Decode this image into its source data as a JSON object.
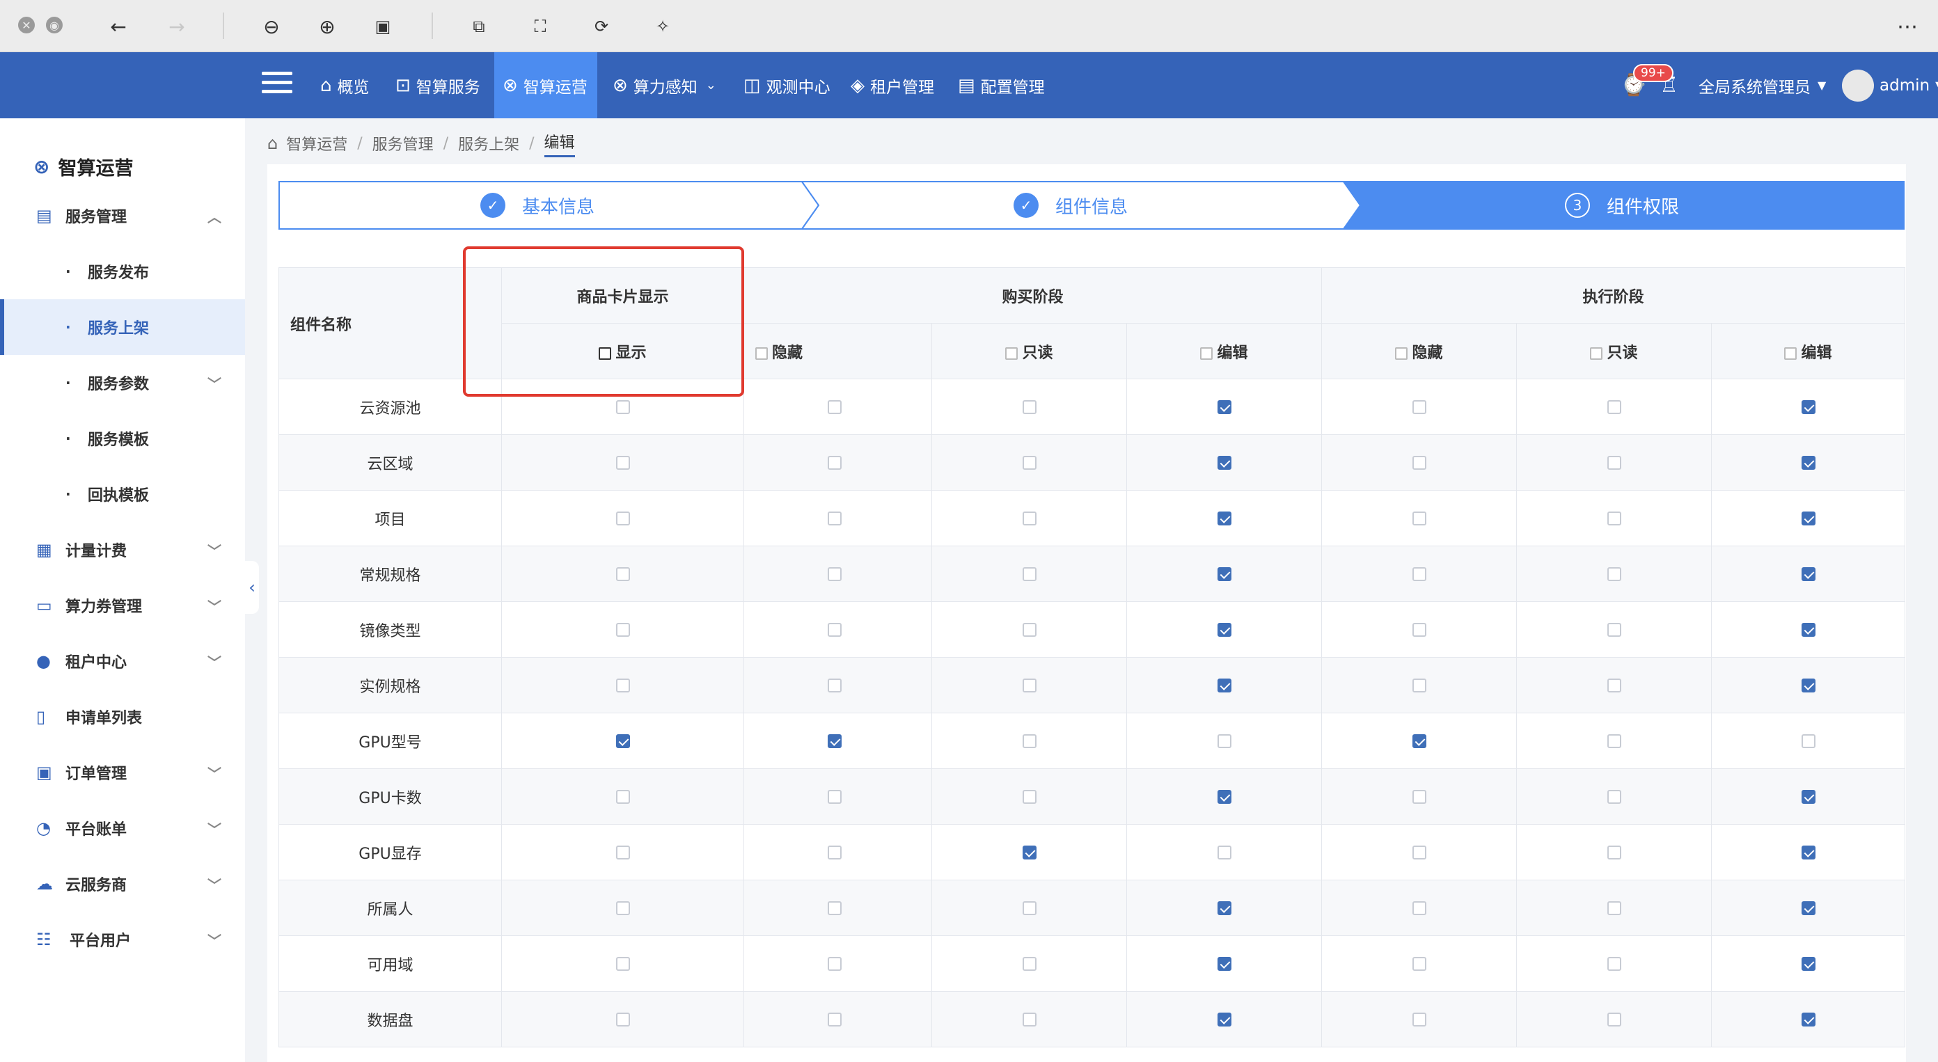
{
  "navbar": {
    "items": [
      {
        "icon": "home-icon",
        "label": "概览"
      },
      {
        "icon": "user-portrait-icon",
        "label": "智算服务"
      },
      {
        "icon": "ops-icon",
        "label": "智算运营"
      },
      {
        "icon": "compute-icon",
        "label": "算力感知"
      },
      {
        "icon": "chart-icon",
        "label": "观测中心"
      },
      {
        "icon": "layers-icon",
        "label": "租户管理"
      },
      {
        "icon": "config-icon",
        "label": "配置管理"
      }
    ],
    "badge": "99+",
    "role": "全局系统管理员",
    "user": "admin"
  },
  "sidebar": {
    "title": "智算运营",
    "groups": [
      {
        "label": "服务管理",
        "chevron": "up"
      },
      {
        "label": "服务发布"
      },
      {
        "label": "服务上架"
      },
      {
        "label": "服务参数"
      },
      {
        "label": "服务模板"
      },
      {
        "label": "回执模板"
      },
      {
        "label": "计量计费"
      },
      {
        "label": "算力券管理"
      },
      {
        "label": "租户中心"
      },
      {
        "label": "申请单列表"
      },
      {
        "label": "订单管理"
      },
      {
        "label": "平台账单"
      },
      {
        "label": "云服务商"
      },
      {
        "label": "平台用户"
      }
    ]
  },
  "breadcrumb": [
    "智算运营",
    "服务管理",
    "服务上架",
    "编辑"
  ],
  "steps": [
    {
      "label": "基本信息",
      "marker": "✓"
    },
    {
      "label": "组件信息",
      "marker": "✓"
    },
    {
      "label": "组件权限",
      "marker": "3"
    }
  ],
  "table": {
    "header_name": "组件名称",
    "group_card": "商品卡片显示",
    "group_buy": "购买阶段",
    "group_exec": "执行阶段",
    "sub_show": "显示",
    "sub_hide": "隐藏",
    "sub_readonly": "只读",
    "sub_edit": "编辑",
    "rows": [
      {
        "name": "云资源池",
        "checks": [
          false,
          false,
          false,
          true,
          false,
          false,
          true
        ]
      },
      {
        "name": "云区域",
        "checks": [
          false,
          false,
          false,
          true,
          false,
          false,
          true
        ]
      },
      {
        "name": "项目",
        "checks": [
          false,
          false,
          false,
          true,
          false,
          false,
          true
        ]
      },
      {
        "name": "常规规格",
        "checks": [
          false,
          false,
          false,
          true,
          false,
          false,
          true
        ]
      },
      {
        "name": "镜像类型",
        "checks": [
          false,
          false,
          false,
          true,
          false,
          false,
          true
        ]
      },
      {
        "name": "实例规格",
        "checks": [
          false,
          false,
          false,
          true,
          false,
          false,
          true
        ]
      },
      {
        "name": "GPU型号",
        "checks": [
          true,
          true,
          false,
          false,
          true,
          false,
          false
        ]
      },
      {
        "name": "GPU卡数",
        "checks": [
          false,
          false,
          false,
          true,
          false,
          false,
          true
        ]
      },
      {
        "name": "GPU显存",
        "checks": [
          false,
          false,
          true,
          false,
          false,
          false,
          true
        ]
      },
      {
        "name": "所属人",
        "checks": [
          false,
          false,
          false,
          true,
          false,
          false,
          true
        ]
      },
      {
        "name": "可用域",
        "checks": [
          false,
          false,
          false,
          true,
          false,
          false,
          true
        ]
      },
      {
        "name": "数据盘",
        "checks": [
          false,
          false,
          false,
          true,
          false,
          false,
          true
        ]
      }
    ]
  }
}
